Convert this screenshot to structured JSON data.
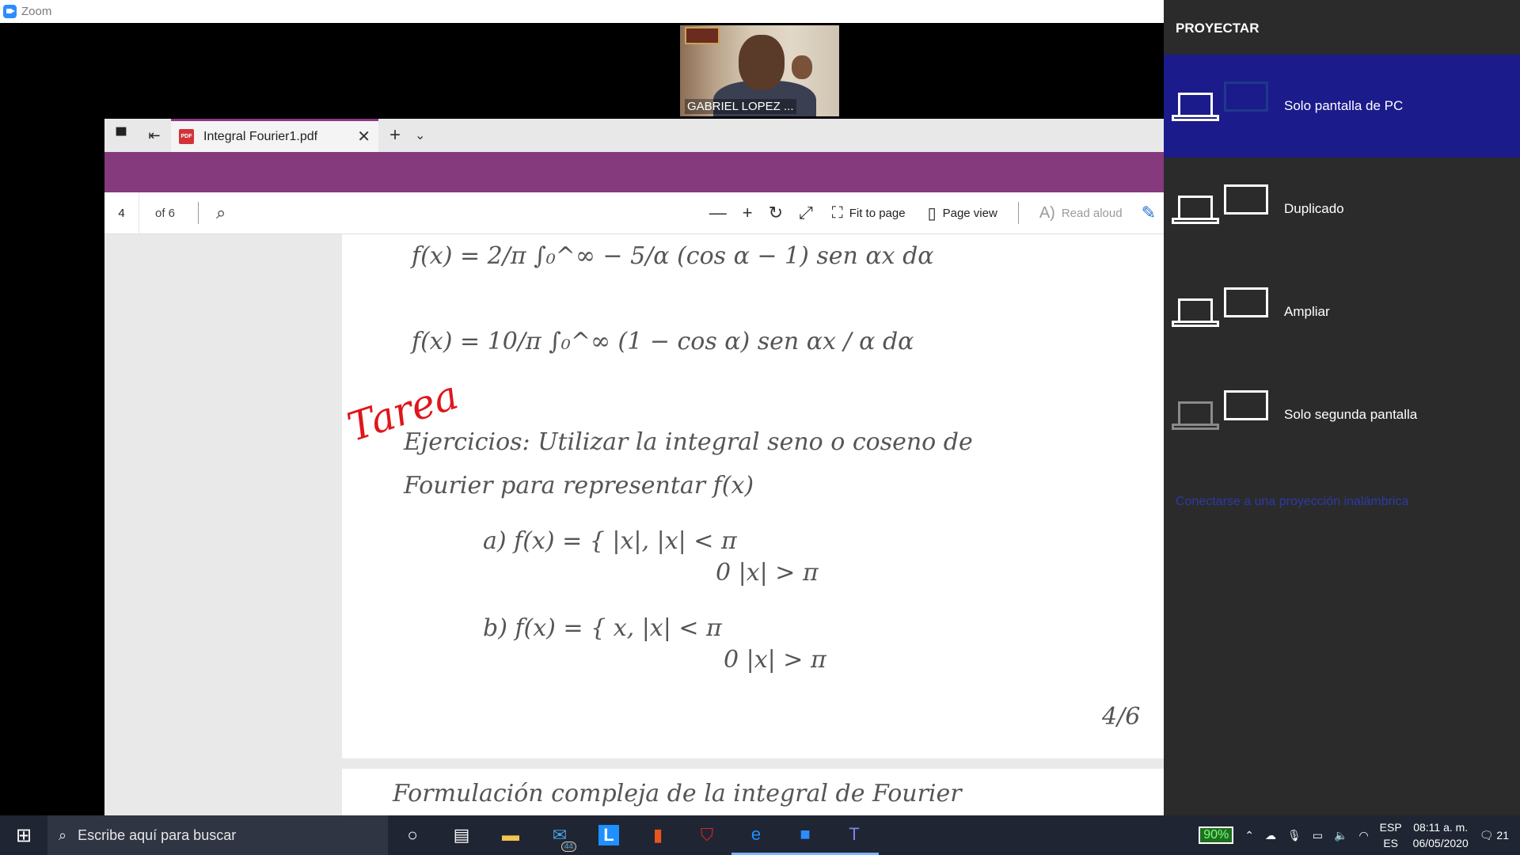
{
  "zoom": {
    "app_title": "Zoom",
    "participant_name": "GABRIEL LOPEZ ..."
  },
  "pdf_viewer": {
    "tab_title": "Integral Fourier1.pdf",
    "page_number": "4",
    "page_count_label": "of 6",
    "fit_to_page_label": "Fit to page",
    "page_view_label": "Page view",
    "read_aloud_label": "Read aloud",
    "page_content": {
      "formula_1": "f(x) = 2/π ∫₀^∞ − 5/α (cos α − 1) sen αx dα",
      "formula_2": "f(x) = 10/π ∫₀^∞ (1 − cos α) sen αx / α dα",
      "tarea": "Tarea",
      "exercise_line_1": "Ejercicios: Utilizar la integral seno o coseno de",
      "exercise_line_2": "Fourier para representar f(x)",
      "part_a": "a) f(x) = { |x|,   |x| < π",
      "part_a_2": "0    |x| > π",
      "part_b": "b) f(x) = { x,   |x| < π",
      "part_b_2": "0    |x| > π",
      "page_label": "4/6",
      "next_page_heading": "Formulación compleja de la integral de Fourier"
    }
  },
  "project_panel": {
    "title": "PROYECTAR",
    "options": [
      {
        "label": "Solo pantalla de PC",
        "selected": true
      },
      {
        "label": "Duplicado",
        "selected": false
      },
      {
        "label": "Ampliar",
        "selected": false
      },
      {
        "label": "Solo segunda pantalla",
        "selected": false
      }
    ],
    "wireless_link": "Conectarse a una proyección inalámbrica"
  },
  "taskbar": {
    "search_placeholder": "Escribe aquí para buscar",
    "mail_badge": "44",
    "battery": "90%",
    "language": "ESP",
    "keyboard": "ES",
    "time": "08:11 a. m.",
    "date": "06/05/2020",
    "notifications": "21"
  }
}
